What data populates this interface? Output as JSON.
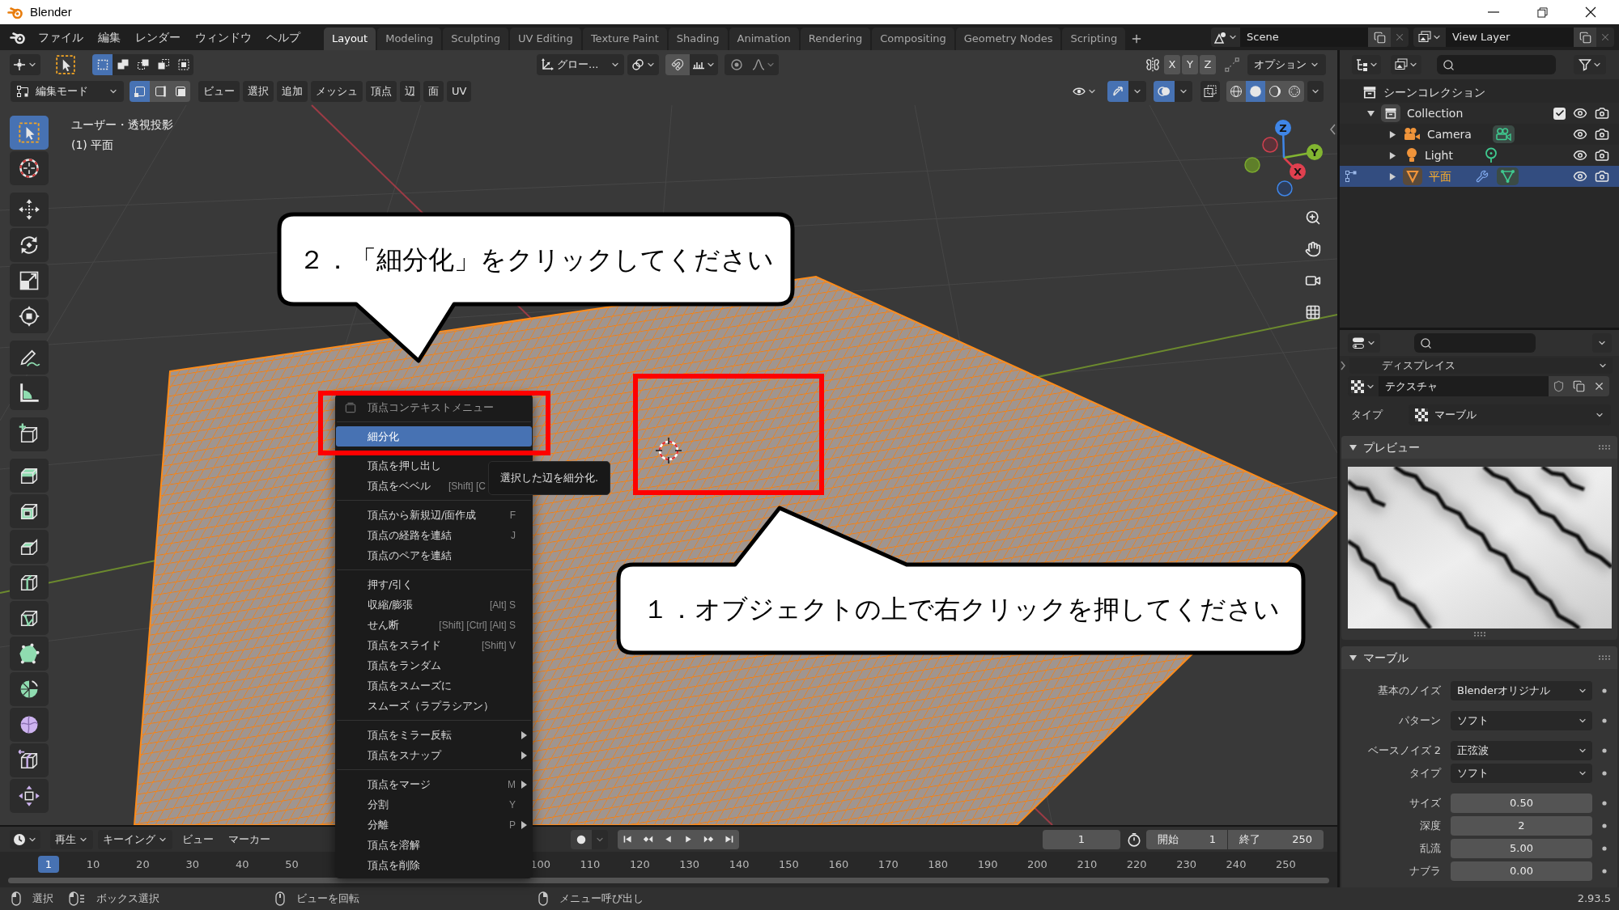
{
  "window": {
    "title": "Blender"
  },
  "menu_bar": [
    "ファイル",
    "編集",
    "レンダー",
    "ウィンドウ",
    "ヘルプ"
  ],
  "workspaces": [
    {
      "label": "Layout",
      "selected": true
    },
    {
      "label": "Modeling",
      "selected": false
    },
    {
      "label": "Sculpting",
      "selected": false
    },
    {
      "label": "UV Editing",
      "selected": false
    },
    {
      "label": "Texture Paint",
      "selected": false
    },
    {
      "label": "Shading",
      "selected": false
    },
    {
      "label": "Animation",
      "selected": false
    },
    {
      "label": "Rendering",
      "selected": false
    },
    {
      "label": "Compositing",
      "selected": false
    },
    {
      "label": "Geometry Nodes",
      "selected": false
    },
    {
      "label": "Scripting",
      "selected": false
    }
  ],
  "scene": "Scene",
  "view_layer": "View Layer",
  "tool_header": {
    "select_actions": [
      {
        "kind": "set",
        "selected": true
      },
      {
        "kind": "extend",
        "selected": false
      },
      {
        "kind": "subtract",
        "selected": false
      },
      {
        "kind": "invert",
        "selected": false
      },
      {
        "kind": "intersect",
        "selected": false
      }
    ],
    "orientation": "グロー...",
    "mirror_axes": [
      {
        "label": "X",
        "on": false
      },
      {
        "label": "Y",
        "on": false
      },
      {
        "label": "Z",
        "on": false
      }
    ],
    "options": "オプション"
  },
  "view_header": {
    "mode": "編集モード",
    "select_modes": [
      {
        "kind": "vertex",
        "selected": true
      },
      {
        "kind": "edge",
        "selected": false
      },
      {
        "kind": "face",
        "selected": false
      }
    ],
    "menus": [
      "ビュー",
      "選択",
      "追加",
      "メッシュ",
      "頂点",
      "辺",
      "面",
      "UV"
    ],
    "gizmos_on": true,
    "overlays_on": true,
    "xray_on": false,
    "shading": [
      {
        "kind": "wireframe",
        "selected": false
      },
      {
        "kind": "solid",
        "selected": true
      },
      {
        "kind": "material",
        "selected": false
      },
      {
        "kind": "rendered",
        "selected": false
      }
    ]
  },
  "viewport": {
    "view_name": "ユーザー・透視投影",
    "object_info": "(1) 平面",
    "axis_labels": [
      "X",
      "Y",
      "Z"
    ]
  },
  "toolbar": {
    "groups": [
      {
        "tools": [
          {
            "kind": "select_box",
            "selected": true
          },
          {
            "kind": "cursor",
            "selected": false
          }
        ]
      },
      {
        "tools": [
          {
            "kind": "move",
            "selected": false
          },
          {
            "kind": "rotate",
            "selected": false
          },
          {
            "kind": "scale",
            "selected": false
          },
          {
            "kind": "transform",
            "selected": false
          }
        ]
      },
      {
        "tools": [
          {
            "kind": "annotate",
            "selected": false
          },
          {
            "kind": "measure",
            "selected": false
          }
        ]
      },
      {
        "tools": [
          {
            "kind": "add_cube",
            "selected": false
          }
        ]
      },
      {
        "tools": [
          {
            "kind": "extrude",
            "selected": false
          },
          {
            "kind": "inset",
            "selected": false
          },
          {
            "kind": "bevel",
            "selected": false
          },
          {
            "kind": "loop_cut",
            "selected": false
          },
          {
            "kind": "knife",
            "selected": false
          },
          {
            "kind": "poly_build",
            "selected": false
          },
          {
            "kind": "spin",
            "selected": false
          },
          {
            "kind": "smooth",
            "selected": false
          },
          {
            "kind": "edge_slide",
            "selected": false
          },
          {
            "kind": "shrink_fatten",
            "selected": false
          }
        ]
      }
    ]
  },
  "context_menu": {
    "title": "頂点コンテキストメニュー",
    "sections": [
      {
        "items": [
          {
            "label": "細分化",
            "selected": true,
            "submenu": false
          }
        ]
      },
      {
        "items": [
          {
            "label": "頂点を押し出し",
            "selected": false,
            "submenu": false
          },
          {
            "label": "頂点をベベル",
            "shortcut": "[Shift] [C",
            "selected": false,
            "submenu": false,
            "covered": true
          }
        ]
      },
      {
        "items": [
          {
            "label": "頂点から新規辺/面作成",
            "shortcut": "F",
            "selected": false,
            "submenu": false,
            "covered": false
          },
          {
            "label": "頂点の経路を連結",
            "shortcut": "J",
            "selected": false,
            "submenu": false,
            "covered": false
          },
          {
            "label": "頂点のペアを連結",
            "selected": false,
            "submenu": false
          }
        ]
      },
      {
        "items": [
          {
            "label": "押す/引く",
            "selected": false,
            "submenu": false
          },
          {
            "label": "収縮/膨張",
            "shortcut": "[Alt] S",
            "selected": false,
            "submenu": false,
            "covered": false
          },
          {
            "label": "せん断",
            "shortcut": "[Shift] [Ctrl] [Alt] S",
            "selected": false,
            "submenu": false,
            "covered": false
          },
          {
            "label": "頂点をスライド",
            "shortcut": "[Shift] V",
            "selected": false,
            "submenu": false,
            "covered": false
          },
          {
            "label": "頂点をランダム",
            "selected": false,
            "submenu": false
          },
          {
            "label": "頂点をスムーズに",
            "selected": false,
            "submenu": false
          },
          {
            "label": "スムーズ（ラプラシアン）",
            "selected": false,
            "submenu": false
          }
        ]
      },
      {
        "items": [
          {
            "label": "頂点をミラー反転",
            "selected": false,
            "submenu": true,
            "covered": false
          },
          {
            "label": "頂点をスナップ",
            "selected": false,
            "submenu": true,
            "covered": false
          }
        ]
      },
      {
        "items": [
          {
            "label": "頂点をマージ",
            "shortcut": "M",
            "selected": false,
            "submenu": true,
            "covered": false
          },
          {
            "label": "分割",
            "shortcut": "Y",
            "selected": false,
            "submenu": false,
            "covered": false
          },
          {
            "label": "分離",
            "shortcut": "P",
            "selected": false,
            "submenu": true,
            "covered": false
          },
          {
            "label": "頂点を溶解",
            "selected": false,
            "submenu": false
          },
          {
            "label": "頂点を削除",
            "selected": false,
            "submenu": false
          }
        ]
      }
    ]
  },
  "tooltip": "選択した辺を細分化.",
  "callouts": [
    {
      "text": "２．「細分化」をクリックしてください"
    },
    {
      "text": "１．オブジェクトの上で右クリックを押してください"
    }
  ],
  "timeline": {
    "menus": [
      {
        "label": "再生",
        "dropdown": true
      },
      {
        "label": "キーイング",
        "dropdown": true
      },
      {
        "label": "ビュー",
        "dropdown": false
      },
      {
        "label": "マーカー",
        "dropdown": false
      }
    ],
    "frame": "1",
    "start": {
      "label": "開始",
      "value": "1"
    },
    "end": {
      "label": "終了",
      "value": "250"
    },
    "ruler": {
      "current": "1",
      "before": [
        "10",
        "20",
        "30",
        "40",
        "50"
      ],
      "after": [
        "100",
        "110",
        "120",
        "130",
        "140",
        "150",
        "160",
        "170",
        "180",
        "190",
        "200",
        "210",
        "220",
        "230",
        "240",
        "250"
      ]
    }
  },
  "outliner": {
    "rows": [
      {
        "label": "シーンコレクション",
        "kind": "scene",
        "selected": false,
        "children": [
          {
            "label": "Collection",
            "kind": "collection",
            "expanded": true,
            "checked": true,
            "selected": false,
            "children": [
              {
                "label": "Camera",
                "kind": "camera",
                "expanded": false,
                "selected": false
              },
              {
                "label": "Light",
                "kind": "light",
                "expanded": false,
                "selected": false
              },
              {
                "label": "平面",
                "kind": "mesh",
                "expanded": false,
                "selected": true
              }
            ]
          }
        ]
      }
    ]
  },
  "properties": {
    "context": "ディスプレイス",
    "texture": "テクスチャ",
    "type": {
      "label": "タイプ",
      "value": "マーブル"
    },
    "preview": {
      "title": "プレビュー",
      "expanded": true
    },
    "marble": {
      "title": "マーブル",
      "expanded": true,
      "groups": [
        {
          "fields": [
            {
              "label": "基本のノイズ",
              "value": "Blenderオリジナル",
              "kind": "dropdown"
            }
          ]
        },
        {
          "fields": [
            {
              "label": "パターン",
              "value": "ソフト",
              "kind": "dropdown"
            }
          ]
        },
        {
          "fields": [
            {
              "label": "ベースノイズ 2",
              "value": "正弦波",
              "kind": "dropdown"
            },
            {
              "label": "タイプ",
              "value": "ソフト",
              "kind": "dropdown"
            }
          ]
        },
        {
          "fields": [
            {
              "label": "サイズ",
              "value": "0.50",
              "kind": "number"
            },
            {
              "label": "深度",
              "value": "2",
              "kind": "number"
            },
            {
              "label": "乱流",
              "value": "5.00",
              "kind": "number"
            },
            {
              "label": "ナブラ",
              "value": "0.00",
              "kind": "number"
            }
          ]
        }
      ]
    }
  },
  "status_bar": {
    "hints": [
      {
        "kind": "left",
        "label": "選択"
      },
      {
        "kind": "drag",
        "label": "ボックス選択"
      },
      {
        "kind": "middle",
        "label": "ビューを回転"
      },
      {
        "kind": "right",
        "label": "メニュー呼び出し"
      }
    ],
    "version": "2.93.5"
  }
}
